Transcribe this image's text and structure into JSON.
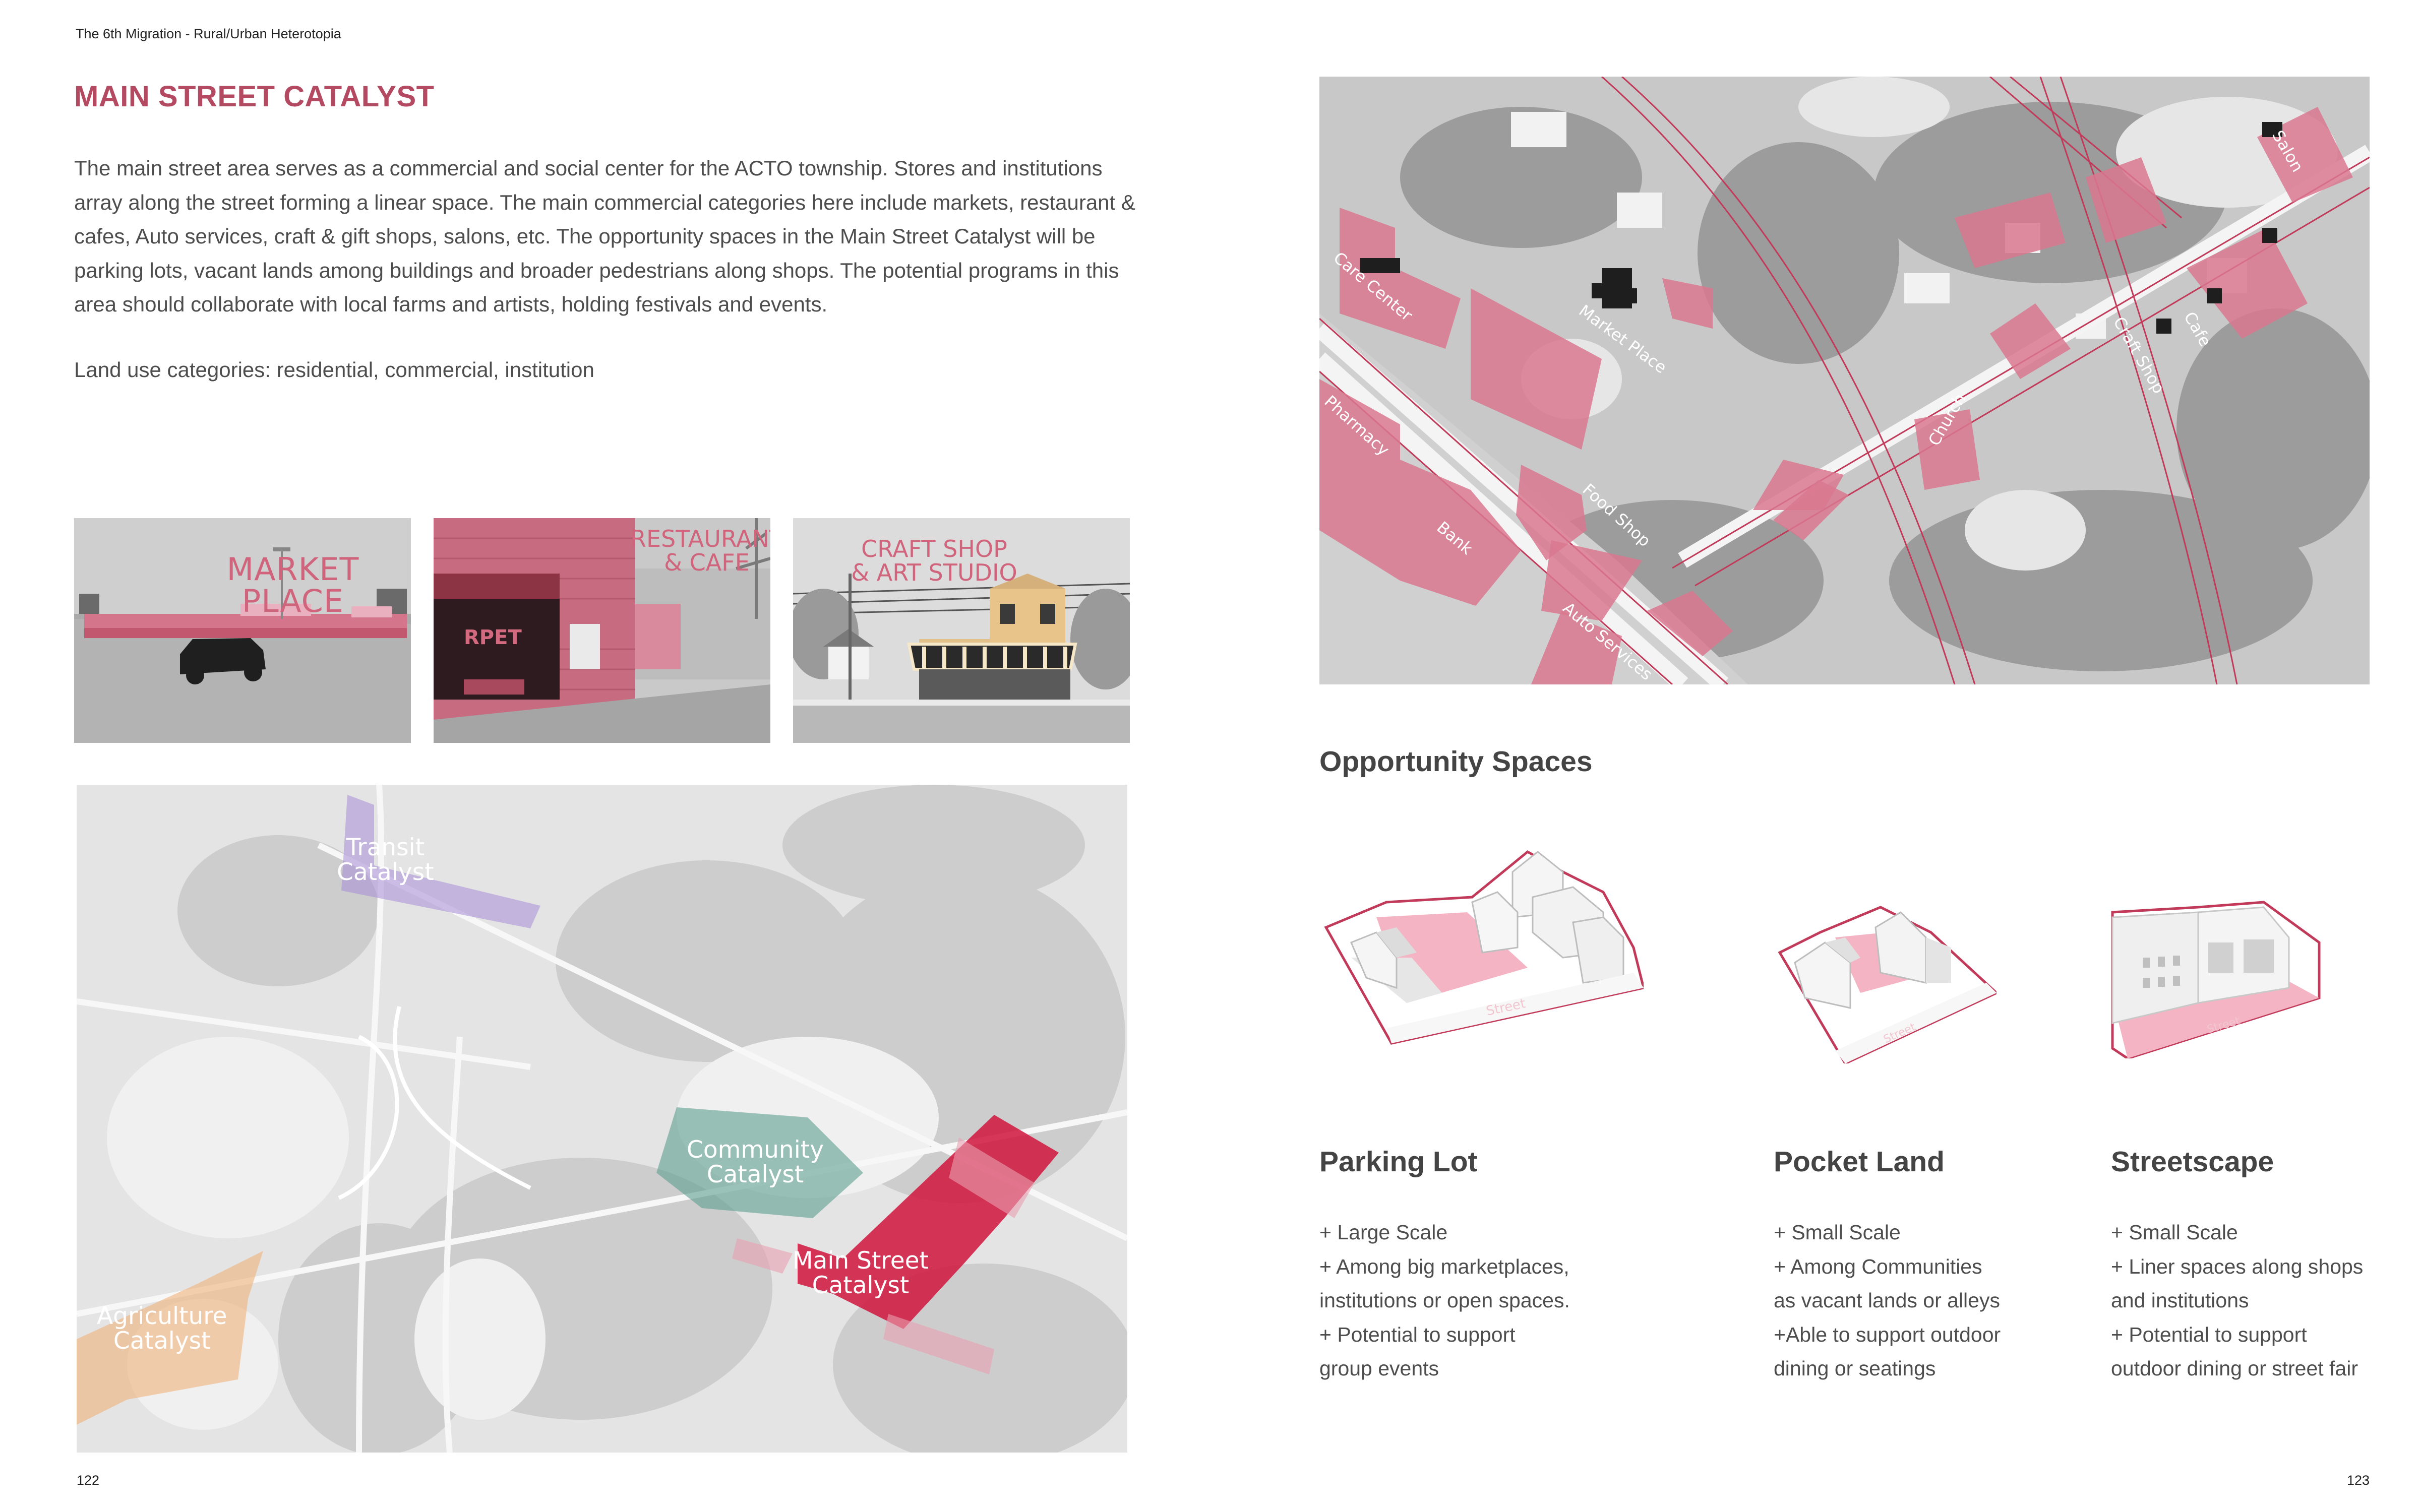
{
  "header": {
    "running_title": "The 6th Migration - Rural/Urban Heterotopia"
  },
  "section": {
    "title": "MAIN STREET CATALYST",
    "intro": "The main street area serves as a commercial and social center for the ACTO township. Stores and institutions array along the street forming a linear space. The main commercial categories here include markets, restaurant & cafes, Auto services, craft & gift shops, salons, etc. The opportunity spaces in the Main Street Catalyst will be parking lots, vacant lands among buildings and broader pedestrians along shops. The potential programs in this area should collaborate with local farms and artists, holding festivals and events.",
    "land_use": "Land use categories: residential, commercial, institution"
  },
  "photos": [
    {
      "label": "MARKET PLACE"
    },
    {
      "label_line1": "RESTAURANT",
      "label_line2": "& CAFE"
    },
    {
      "label_line1": "CRAFT SHOP",
      "label_line2": "& ART STUDIO"
    }
  ],
  "catalyst_map": {
    "transit": {
      "line1": "Transit",
      "line2": "Catalyst",
      "color": "#a58cd6"
    },
    "community": {
      "line1": "Community",
      "line2": "Catalyst",
      "color": "#5e9f8d"
    },
    "main_street": {
      "line1": "Main Street",
      "line2": "Catalyst",
      "color": "#d0143c"
    },
    "agriculture": {
      "line1": "Agriculture",
      "line2": "Catalyst",
      "color": "#f0b27a"
    }
  },
  "aerial_map": {
    "labels": {
      "care_center": "Care Center",
      "market_place": "Market Place",
      "pharmacy": "Pharmacy",
      "bank": "Bank",
      "food_shop": "Food Shop",
      "auto_services": "Auto Services",
      "church": "Church",
      "craft_shop": "Craft Shop",
      "cafe": "Cafe",
      "salon": "Salon"
    },
    "highlight_color": "#d9788f",
    "road_color": "#c23a5a"
  },
  "opportunity": {
    "title": "Opportunity Spaces",
    "items": [
      {
        "name": "Parking Lot",
        "street_label": "Street",
        "points": [
          "+ Large Scale",
          "+ Among big marketplaces,",
          "institutions or open spaces.",
          "+ Potential to support",
          "group events"
        ]
      },
      {
        "name": "Pocket Land",
        "street_label": "Street",
        "points": [
          "+ Small Scale",
          "+ Among Communities",
          "as vacant lands or alleys",
          "+Able to support outdoor",
          "dining or seatings"
        ]
      },
      {
        "name": "Streetscape",
        "street_label": "Street",
        "points": [
          "+ Small Scale",
          "+ Liner spaces along shops",
          "and institutions",
          "+ Potential to support",
          "outdoor dining or street fair"
        ]
      }
    ]
  },
  "footer": {
    "page_left": "122",
    "page_right": "123"
  }
}
